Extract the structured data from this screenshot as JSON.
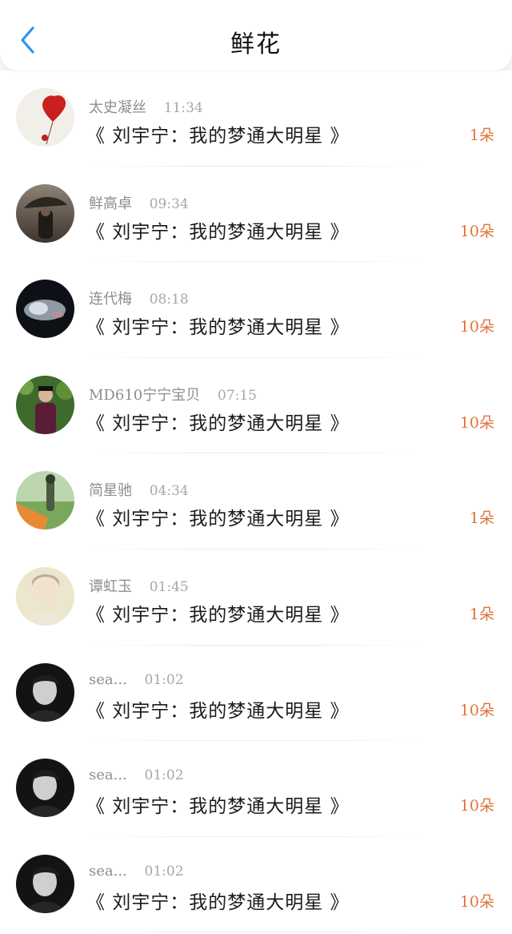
{
  "header": {
    "title": "鲜花",
    "back_icon": "chevron-left-icon",
    "accent_color": "#2f95e8"
  },
  "colors": {
    "count": "#e0743a"
  },
  "rows": [
    {
      "name": "太史凝丝",
      "time": "11:34",
      "book": "《 刘宇宁：我的梦通大明星 》",
      "count": "1朵",
      "avatar": "red-heart-balloon"
    },
    {
      "name": "鲜高卓",
      "time": "09:34",
      "book": "《 刘宇宁：我的梦通大明星 》",
      "count": "10朵",
      "avatar": "couple-umbrella"
    },
    {
      "name": "连代梅",
      "time": "08:18",
      "book": "《 刘宇宁：我的梦通大明星 》",
      "count": "10朵",
      "avatar": "dark-wave-dress"
    },
    {
      "name": "MD610宁宁宝贝",
      "time": "07:15",
      "book": "《 刘宇宁：我的梦通大明星 》",
      "count": "10朵",
      "avatar": "man-purple-suit"
    },
    {
      "name": "简星驰",
      "time": "04:34",
      "book": "《 刘宇宁：我的梦通大明星 》",
      "count": "1朵",
      "avatar": "girl-field-orange"
    },
    {
      "name": "谭虹玉",
      "time": "01:45",
      "book": "《 刘宇宁：我的梦通大明星 》",
      "count": "1朵",
      "avatar": "pale-portrait"
    },
    {
      "name": "sea...",
      "time": "01:02",
      "book": "《 刘宇宁：我的梦通大明星 》",
      "count": "10朵",
      "avatar": "dark-portrait"
    },
    {
      "name": "sea...",
      "time": "01:02",
      "book": "《 刘宇宁：我的梦通大明星 》",
      "count": "10朵",
      "avatar": "dark-portrait"
    },
    {
      "name": "sea...",
      "time": "01:02",
      "book": "《 刘宇宁：我的梦通大明星 》",
      "count": "10朵",
      "avatar": "dark-portrait"
    }
  ]
}
